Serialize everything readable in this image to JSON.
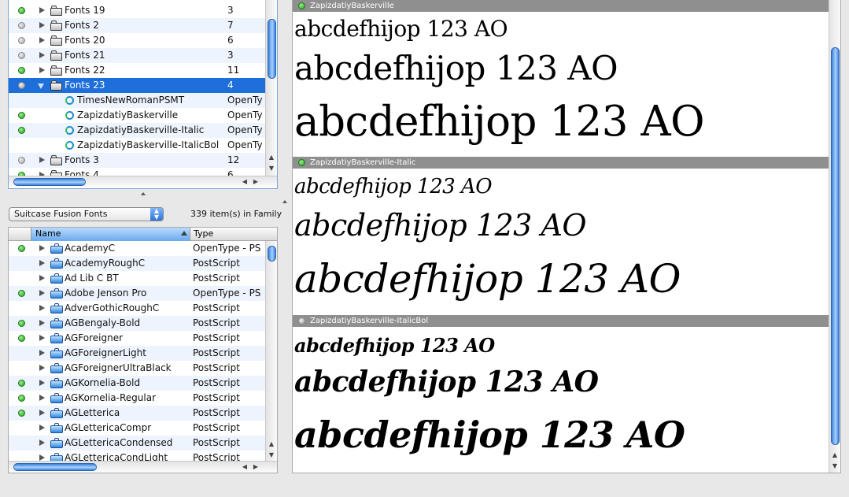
{
  "sets": {
    "rows": [
      {
        "label": "Fonts 19",
        "count": "3",
        "status": "green"
      },
      {
        "label": "Fonts 2",
        "count": "7",
        "status": "gray"
      },
      {
        "label": "Fonts 20",
        "count": "6",
        "status": "gray"
      },
      {
        "label": "Fonts 21",
        "count": "3",
        "status": "gray"
      },
      {
        "label": "Fonts 22",
        "count": "11",
        "status": "green"
      },
      {
        "label": "Fonts 23",
        "count": "4",
        "status": "gray"
      }
    ],
    "children": [
      {
        "label": "TimesNewRomanPSMT",
        "type": "OpenTy"
      },
      {
        "label": "ZapizdatiyBaskerville",
        "type": "OpenTy"
      },
      {
        "label": "ZapizdatiyBaskerville-Italic",
        "type": "OpenTy"
      },
      {
        "label": "ZapizdatiyBaskerville-ItalicBol",
        "type": "OpenTy"
      }
    ],
    "after": [
      {
        "label": "Fonts 3",
        "count": "12",
        "status": "gray"
      },
      {
        "label": "Fonts 4",
        "count": "6",
        "status": "green"
      }
    ]
  },
  "library": {
    "selected": "Suitcase Fusion Fonts",
    "item_count": "339 item(s) in Family"
  },
  "fonts_list": {
    "col_name": "Name",
    "col_type": "Type",
    "rows": [
      {
        "label": "AcademyC",
        "type": "OpenType - PS",
        "status": "green"
      },
      {
        "label": "AcademyRoughC",
        "type": "PostScript",
        "status": ""
      },
      {
        "label": "Ad Lib C BT",
        "type": "PostScript",
        "status": ""
      },
      {
        "label": "Adobe Jenson Pro",
        "type": "OpenType - PS",
        "status": "green"
      },
      {
        "label": "AdverGothicRoughC",
        "type": "PostScript",
        "status": ""
      },
      {
        "label": "AGBengaly-Bold",
        "type": "PostScript",
        "status": "green"
      },
      {
        "label": "AGForeigner",
        "type": "PostScript",
        "status": "green"
      },
      {
        "label": "AGForeignerLight",
        "type": "PostScript",
        "status": ""
      },
      {
        "label": "AGForeignerUltraBlack",
        "type": "PostScript",
        "status": ""
      },
      {
        "label": "AGKornelia-Bold",
        "type": "PostScript",
        "status": "green"
      },
      {
        "label": "AGKornelia-Regular",
        "type": "PostScript",
        "status": "green"
      },
      {
        "label": "AGLetterica",
        "type": "PostScript",
        "status": "green"
      },
      {
        "label": "AGLettericaCompr",
        "type": "PostScript",
        "status": ""
      },
      {
        "label": "AGLettericaCondensed",
        "type": "PostScript",
        "status": ""
      },
      {
        "label": "AGLettericaCondLight",
        "type": "PostScript",
        "status": ""
      }
    ]
  },
  "preview": {
    "sample_text": "abcdefhijop 123 AO",
    "groups": [
      {
        "name": "ZapizdatiyBaskerville",
        "status": "green",
        "style": "regular"
      },
      {
        "name": "ZapizdatiyBaskerville-Italic",
        "status": "green",
        "style": "italic"
      },
      {
        "name": "ZapizdatiyBaskerville-ItalicBol",
        "status": "gray",
        "style": "bolditalic"
      }
    ]
  },
  "colors": {
    "selection": "#1e6fd9",
    "row_alt": "#eef4fd",
    "preview_header": "#8f8f8f",
    "active_green": "#1e9a1e"
  },
  "icons": [
    "folder-icon",
    "opentype-font-icon",
    "suitcase-icon",
    "disclosure-triangle-icon",
    "status-dot-icon"
  ]
}
